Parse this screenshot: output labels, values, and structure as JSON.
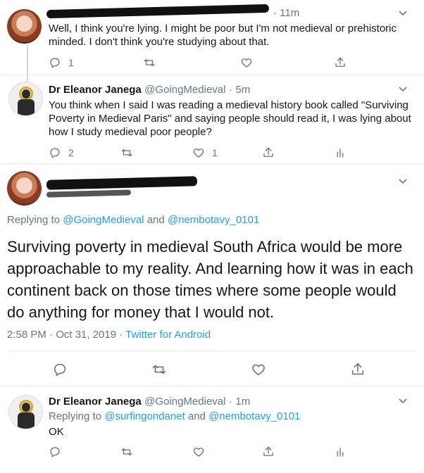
{
  "tweets": [
    {
      "time": "11m",
      "text": "Well, I think you're lying. I might be poor but I'm not medieval or prehistoric minded. I don't think you're studying about that.",
      "reply_count": "1",
      "retweet_count": "",
      "like_count": ""
    },
    {
      "name": "Dr Eleanor Janega",
      "handle": "@GoingMedieval",
      "time": "5m",
      "text": "You think when I said I was reading a medieval history book called \"Surviving Poverty in Medieval Paris\" and saying people should read it, I was lying about how I study medieval poor people?",
      "reply_count": "2",
      "retweet_count": "",
      "like_count": "1"
    },
    {
      "replying_label": "Replying to",
      "mention1": "@GoingMedieval",
      "and": "and",
      "mention2": "@nembotavy_0101",
      "text": "Surviving poverty in medieval South Africa would be more approachable to my reality. And learning how it was in each continent back on those times where some people would do anything for money that I would not.",
      "timestamp": "2:58 PM · Oct 31, 2019",
      "source": "Twitter for Android"
    },
    {
      "name": "Dr Eleanor Janega",
      "handle": "@GoingMedieval",
      "time": "1m",
      "replying_label": "Replying to",
      "mention1": "@surfingondanet",
      "and": "and",
      "mention2": "@nembotavy_0101",
      "text": "OK"
    }
  ],
  "separator": "·",
  "icons": [
    "reply-icon",
    "retweet-icon",
    "like-icon",
    "share-icon",
    "analytics-icon",
    "caret-down-icon"
  ],
  "colors": {
    "link": "#1da1f2",
    "muted": "#657786",
    "line": "#ccd6dd"
  }
}
